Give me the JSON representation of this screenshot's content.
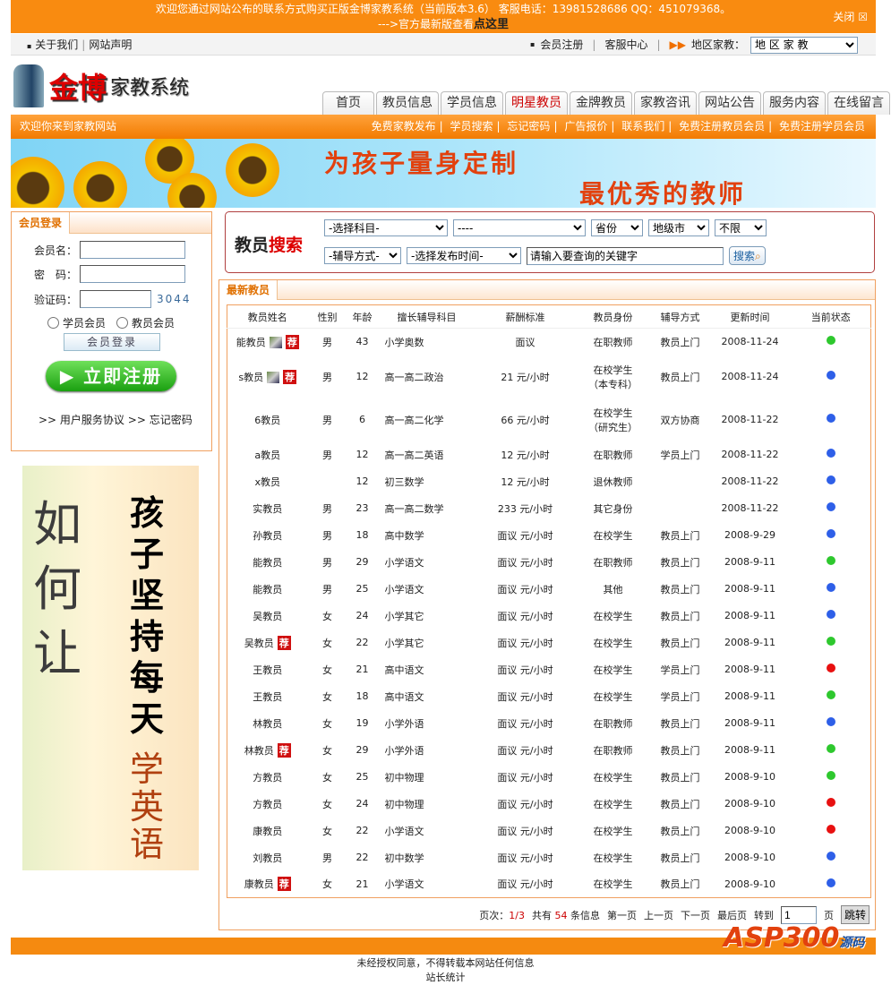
{
  "promo": {
    "line1": "欢迎您通过网站公布的联系方式购买正版金博家教系统（当前版本3.6） 客服电话：13981528686 QQ：451079368。",
    "line2_prefix": "--->官方最新版查看",
    "line2_link": "点这里",
    "close": "关闭 ☒"
  },
  "topnav": {
    "about": "关于我们",
    "statement": "网站声明",
    "register": "会员注册",
    "service": "客服中心",
    "region_label": "地区家教：",
    "region_select": "地 区 家 教"
  },
  "logo": {
    "brand": "金博",
    "system": "家教系统"
  },
  "tabs": [
    "首页",
    "教员信息",
    "学员信息",
    "明星教员",
    "金牌教员",
    "家教咨讯",
    "网站公告",
    "服务内容",
    "在线留言"
  ],
  "subnav": {
    "welcome": "欢迎你来到家教网站",
    "links": [
      "免费家教发布",
      "学员搜索",
      "忘记密码",
      "广告报价",
      "联系我们",
      "免费注册教员会员",
      "免费注册学员会员"
    ]
  },
  "banner": {
    "line1": "为孩子量身定制",
    "line2": "最优秀的教师"
  },
  "login": {
    "title": "会员登录",
    "username_label": "会员名：",
    "password_label": "密　码：",
    "captcha_label": "验证码：",
    "captcha": "3044",
    "radio_student": "学员会员",
    "radio_teacher": "教员会员",
    "submit": "会员登录",
    "register": "立即注册",
    "agreement": ">> 用户服务协议",
    "forgot": ">> 忘记密码"
  },
  "ad": {
    "part1": "如何让",
    "part2": "孩子坚持每天",
    "part3": "学英语"
  },
  "search": {
    "title_a": "教员",
    "title_b": "搜索",
    "subject": "-选择科目-",
    "sub2": "----",
    "province": "省份",
    "city": "地级市",
    "limit": "不限",
    "mode": "-辅导方式-",
    "time": "-选择发布时间-",
    "keyword_placeholder": "请输入要查询的关键字",
    "button": "搜索"
  },
  "list": {
    "title": "最新教员",
    "headers": [
      "教员姓名",
      "性别",
      "年龄",
      "擅长辅导科目",
      "薪酬标准",
      "教员身份",
      "辅导方式",
      "更新时间",
      "当前状态"
    ],
    "rows": [
      [
        "能教员",
        true,
        true,
        "男",
        "43",
        "小学奥数",
        "面议",
        "在职教师",
        "教员上门",
        "2008-11-24",
        "green"
      ],
      [
        "s教员",
        true,
        true,
        "男",
        "12",
        "高一高二政治",
        "21 元/小时",
        "在校学生（本专科）",
        "教员上门",
        "2008-11-24",
        "blue"
      ],
      [
        "6教员",
        false,
        false,
        "男",
        "6",
        "高一高二化学",
        "66 元/小时",
        "在校学生（研究生）",
        "双方协商",
        "2008-11-22",
        "blue"
      ],
      [
        "a教员",
        false,
        false,
        "男",
        "12",
        "高一高二英语",
        "12 元/小时",
        "在职教师",
        "学员上门",
        "2008-11-22",
        "blue"
      ],
      [
        "x教员",
        false,
        false,
        "",
        "12",
        "初三数学",
        "12 元/小时",
        "退休教师",
        "",
        "2008-11-22",
        "blue"
      ],
      [
        "实教员",
        false,
        false,
        "男",
        "23",
        "高一高二数学",
        "233 元/小时",
        "其它身份",
        "",
        "2008-11-22",
        "blue"
      ],
      [
        "孙教员",
        false,
        false,
        "男",
        "18",
        "高中数学",
        "面议 元/小时",
        "在校学生",
        "教员上门",
        "2008-9-29",
        "blue"
      ],
      [
        "能教员",
        false,
        false,
        "男",
        "29",
        "小学语文",
        "面议 元/小时",
        "在职教师",
        "教员上门",
        "2008-9-11",
        "green"
      ],
      [
        "能教员",
        false,
        false,
        "男",
        "25",
        "小学语文",
        "面议 元/小时",
        "其他",
        "教员上门",
        "2008-9-11",
        "blue"
      ],
      [
        "吴教员",
        false,
        false,
        "女",
        "24",
        "小学其它",
        "面议 元/小时",
        "在校学生",
        "教员上门",
        "2008-9-11",
        "blue"
      ],
      [
        "吴教员",
        false,
        true,
        "女",
        "22",
        "小学其它",
        "面议 元/小时",
        "在校学生",
        "教员上门",
        "2008-9-11",
        "green"
      ],
      [
        "王教员",
        false,
        false,
        "女",
        "21",
        "高中语文",
        "面议 元/小时",
        "在校学生",
        "学员上门",
        "2008-9-11",
        "red"
      ],
      [
        "王教员",
        false,
        false,
        "女",
        "18",
        "高中语文",
        "面议 元/小时",
        "在校学生",
        "学员上门",
        "2008-9-11",
        "green"
      ],
      [
        "林教员",
        false,
        false,
        "女",
        "19",
        "小学外语",
        "面议 元/小时",
        "在职教师",
        "教员上门",
        "2008-9-11",
        "blue"
      ],
      [
        "林教员",
        false,
        true,
        "女",
        "29",
        "小学外语",
        "面议 元/小时",
        "在职教师",
        "教员上门",
        "2008-9-11",
        "green"
      ],
      [
        "方教员",
        false,
        false,
        "女",
        "25",
        "初中物理",
        "面议 元/小时",
        "在校学生",
        "教员上门",
        "2008-9-10",
        "green"
      ],
      [
        "方教员",
        false,
        false,
        "女",
        "24",
        "初中物理",
        "面议 元/小时",
        "在校学生",
        "教员上门",
        "2008-9-10",
        "red"
      ],
      [
        "康教员",
        false,
        false,
        "女",
        "22",
        "小学语文",
        "面议 元/小时",
        "在校学生",
        "教员上门",
        "2008-9-10",
        "red"
      ],
      [
        "刘教员",
        false,
        false,
        "男",
        "22",
        "初中数学",
        "面议 元/小时",
        "在校学生",
        "教员上门",
        "2008-9-10",
        "blue"
      ],
      [
        "康教员",
        false,
        true,
        "女",
        "21",
        "小学语文",
        "面议 元/小时",
        "在校学生",
        "教员上门",
        "2008-9-10",
        "blue"
      ]
    ],
    "recommend_badge": "荐",
    "pager": {
      "page_label": "页次：",
      "page": "1/3",
      "total_prefix": "共有",
      "total": "54",
      "total_suffix": "条信息",
      "first": "第一页",
      "prev": "上一页",
      "next": "下一页",
      "last": "最后页",
      "goto": "转到",
      "goto_value": "1",
      "page_unit": "页",
      "jump": "跳转"
    }
  },
  "status_colors": {
    "green": "#2ec82e",
    "blue": "#2e5fe8",
    "red": "#e81010"
  },
  "footer": {
    "line1": "未经授权同意，不得转载本网站任何信息",
    "line2": "站长统计",
    "watermark": "ASP300",
    "watermark_sub": "源码"
  }
}
